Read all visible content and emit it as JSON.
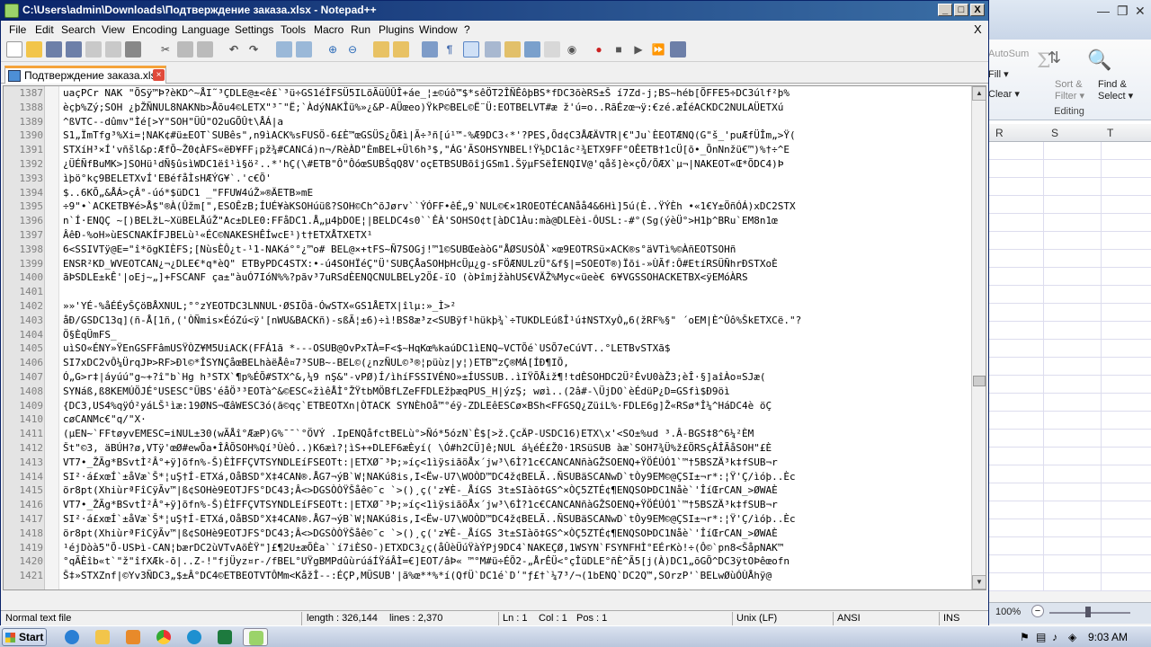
{
  "window": {
    "title": "C:\\Users\\admin\\Downloads\\Подтверждение заказа.xlsx - Notepad++",
    "min": "_",
    "max": "□",
    "close": "X"
  },
  "menu": [
    "File",
    "Edit",
    "Search",
    "View",
    "Encoding",
    "Language",
    "Settings",
    "Tools",
    "Macro",
    "Run",
    "Plugins",
    "Window",
    "?"
  ],
  "menu_close": "X",
  "tab": {
    "label": "Подтверждение заказа.xlsx"
  },
  "editor": {
    "lines": [
      {
        "n": "1387",
        "t": "uaçPCr NAK \"ÕSÿ™Þ?èKD^~ÅI˜³ÇDLE@±<ê£`³ü÷GS1éÎFSÜ5ILõÃüÛÛÎ+áe_¦±©úô™$*sêÖT2ÎÑÊôþBS*fDC3õèRS±Š í7Zd-j;BS~héb[ÕFFE5÷DC3úlf²þ%"
      },
      {
        "n": "1388",
        "t": "èçþ%Zý;SOH ¿þŽÑNUL8NAKNb>Åõu4©LETX\"³¯\"Ë;`ÀdýNAKÎü%»¿&P-AÜœeo)ŸkP©BEL©Ë¨Ü:EOTBELVT#æ ž'ú=o..RãÉzœ¬ÿ:€zé.æÍéACKDC2NULAÜETXú"
      },
      {
        "n": "1389",
        "t": "^ßVTC--dûmv\"Ìé[>Y\"SOH\"ÜÛ\"O2uGÕÛt\\ÅÁ|a"
      },
      {
        "n": "1390",
        "t": "S1„ÏmTfg³%Xi=¦NAK¢#ü±EOT`SUBês\",n9ìACK%sFUSÖ-6£È™œGSÜS¿ÕÆì|Ã÷³ñ[ú¹™-%Æ9DC3‹*'?PES,Õd¢C3ÅÆÄVTR|€\"Ju`ÈEOTÆNQ(G\"š_'puÆfÜÎm„>Ÿ("
      },
      {
        "n": "1391",
        "t": "STXíH³×Í'vñšl&p:ÆfÕ~Ž0¢ÀFS«ëÐ¥FF¡pž¾#CANCá)n¬/RèÀD\"ÈmBEL+Ül6h³$,\"ÁG'ÃSOHSYNBEL!Ÿ½DC1âc²¾ETX9FF°OÊETB†1cÜ[õ•_ÕnNnžü€™)%†÷^E"
      },
      {
        "n": "1392",
        "t": "¿ÜÉÑfBuMK>]SOHü¹dÑ§ûsìWDC1ëî¹ì§ö²..*'hÇ(\\#ETB\"Ô\"ÔóœSUBŠqQ8V'oçETBSUBõîjGSm1.ŠÿµFSëÎENQIV@'qåš]è×çÕ/ÕÆX`µ¬|NAKEOT«Œ*ÕDC4)Þ"
      },
      {
        "n": "1393",
        "t": "ìþö°kç9BELETXvÍ'EBéfåÌsHÆÝG¥`.'c€Õ'"
      },
      {
        "n": "1394",
        "t": "$..6KÕ„&ÅÁ>çÂ°-úó*$üDC1 _\"FFUW4úŽ»®ÄETB»mE"
      },
      {
        "n": "1395",
        "t": "÷9\"•`ACKETB¥é>Å$\"®À(Ûžm[\",ESOÊzB;ÍUÉ¥àKSOHúüß?SOH©Ch^õJørv``ÝÓFF•êÉ„9`NUL©€×1ROEOTÉCANåå4&6Hì]5ú(È..ŸÝÈh •«1€Y±ÖñÓÁ)xDC2STX"
      },
      {
        "n": "1396",
        "t": "n`Í·ENQÇ ~[)BELžL~XüBELÅúŽ\"Ac±DLE0:FFåDC1.Å„µ4þDOE¦|BELDC4s0``ÊÀ'SOHSO¢t[àDC1Àu:mà@DLEèi-ÔUSL:-#°(Sg(ýèÜ°>H1þ^BRu`EM8n1œ"
      },
      {
        "n": "1397",
        "t": "ÂêÐ-%oH»ùESCNAKÍFJBELù¹«ÉC©NAKESHÊÍwcE¹)t†ETXÅTXETX¹"
      },
      {
        "n": "1398",
        "t": "6<SSIVTÿ@E=\"î*õgKIÈFS;[NùsÈÔ¿t-¹1-NAKá°°¿™o# BEL@×+tFS~Ñ7SOGj!™1©SUBŒeàòG\"ÅØSUSÒÅ`×œ9EOTRSü×ACK®s°äVTì%©ÀñEOTSOHñ"
      },
      {
        "n": "1399",
        "t": "ENSR²KD_WVEOTCAN¿¬¿DLE€*q*èQ\" ETByPDC4STX:•-ú4SOHÏéÇ\"Ü'SUBÇÅaSOHþHcÜµ¿g-sFÖÆNULzÜ°&f§|=SOEOT®)Ïõi-»ÙÃf:Ô#EtíRSÜÑhrÐSTXoÈ"
      },
      {
        "n": "1400",
        "t": "ãÞSDLE±kÊ'|oEj~„]+FSCANF ça±\"àuÓ7IóN%%?pãv³7uRSdÈENQCNULBELy2Ö£-ïO (òÞîmjžàhUS€VÄŽ%Myc«üeè€ 6¥VGSSOHACKETBX<ÿEMóÀRS"
      },
      {
        "n": "1401",
        "t": ""
      },
      {
        "n": "1402",
        "t": "»»'YÉ-%åÉÉyŠÇöBÅXNUL;°°zYEOTDC3LNNUL·ØSIÖã-ÓwSTX«GS1ÅETX|îlµ:»_Ì>²"
      },
      {
        "n": "1403",
        "t": "åÐ/GSDC13q](ñ-Å[1ñ,('ÒÑmis×ÉóZú<ÿ'[nWU&BACKñ)-sßÃ¦±6)÷ì!BS8æ³z<SUBÿf¹hükþ¾`÷TUKDLEúßÎ¹ú‡NSTXyÒ„6(žRF%§\" ´oEM|È^Ûô%ŠkETXCë.\"?"
      },
      {
        "n": "1404",
        "t": "Ö§ÈqÜmFS_"
      },
      {
        "n": "1405",
        "t": "uìSO«ÉNY»ŸEnGSFFâmUSŸÒZ¥M5UiACK(FFÁ1ã *---OSUB@OvPxTÀ=F<$~HqKœ%kaúDC1ìENQ~VCTÕé`USÕ7eCúVT..°LETBvSTXã$"
      },
      {
        "n": "1406",
        "t": "SI7xDC2vÔ¼ÜrqJÞ>RF>Ðl©*ÎSYNÇåœBELhàëÅê¤7³SUB~-BEL©(¿nzÑUL©³®¦püùz|y¦)ETB™zÇ®MÁ[ÍÐ¶IŎ,"
      },
      {
        "n": "1407",
        "t": "Ó„G>r‡|áyúú\"g~+?î\"b`Hg h³STX`¶p%ÉÕ#STX^&,¼9 nŞ&\"-vPØ)Í/ìhíFSSIVÉNO»±ÍUSSUB..ìIŸÕÅiž¶!tdÈSOHDC2Ü²ÊvU0àŽ3;èÎ·§]aîÀo¤SJæ("
      },
      {
        "n": "1408",
        "t": "SYNáß,ß8KEMÚÖJÉ°USESC°ÜBS'éåÖ³³EOTà^&©ESC«žìêÅÌ°ŽŸtbMÖBfLZeFFDLEžþæqPUS_H|ýzŞ; wøì..(2â#-\\ÜjDO`èÉdüP¿D=GSfì$Ð9öì"
      },
      {
        "n": "1409",
        "t": "{DC3,US4%qÿÓ²yáLŠ¹ìæ:19ØNS¬ŒâWESC3ó(ã©qç`ETBEOTXn|ÒTACK SYNÈhOå™°éÿ-ZDLEêESCø×BSh<FFGSQ¿ZüiL%·FDLE6g]Ž«RSø*Î¼^HáDC4è öÇ"
      },
      {
        "n": "1410",
        "t": "cøCANMc€\"q/\"X·"
      },
      {
        "n": "1411",
        "t": "(µEN~`FFtøyvEMESC=iNUL±30(wÃÅî°ÆæP)G%¯¯`°ÖVÝ .IpENQåfctBELù°>Ñó*5ózN`È$[>ž.ÇcÄP-USDC16)ETX\\x'<SO±%ud ³.Â-BGS‡8^6¼²ÈM"
      },
      {
        "n": "1412",
        "t": "Št\"©3, äBÚH?ø,VTÿ'œØ#ewÕa•ÎÂÕSOH%Qí³ÙèÓ..)K6æì?¦ìS++DLEF6æÈyí( \\Ó#h2CÜ]ê;NUL á¼éÉ£Ž0·1RSüSUB àæ`SOH7¾Ü%ž£ÖRSçÂÎÃåSOH\"£È"
      },
      {
        "n": "1413",
        "t": "VT7•_ŽÃg*BSvtÌ²Â°+ÿ]õfn%-Š)ÈÌFFÇVTSYNDLEíFSEOTt:|ETXØ¯³Þ;»íç<1ìÿsiãöÅx´jw³\\6Ì?1c€CANCANñàGŽSOENQ+ŸÖÉÚÓ1`™†5BSZÄ³k‡fSUB¬r"
      },
      {
        "n": "1414",
        "t": "SI²·á£xœÍ`±åVæ`Š*¦uŞ†Í-ETXá,OåBSD°X‡4CAN®.ÅG7¬ýB`W¦NAKú8is,I<Ëw-U7\\WOÒD™DC4ž¢BELÃ..ÑSUBäSCANwD`tÒy9EM©@ÇSI±¬r*:¦Ÿ'Ç/ìóþ..Èc"
      },
      {
        "n": "1415",
        "t": "ör8pt(XhiùrªFîCÿÃv™|ß¢SOHè9EOTJFS°DC43;Â<>DGSÒÒŸŠåê©¯c `>()¸ç('z¥È-_ÅíGS 3t±SIàõ‡GS^×ÒÇ5ZTÉ¢¶ENQSOÞDC1Nåè`'ÎíŒrCAN_>ØWAÈ"
      },
      {
        "n": "1416",
        "t": "VT7•_ŽÃg*BSvtÌ²Â°+ÿ]õfn%-Š)ÈÌFFÇVTSYNDLEíFSEOTt:|ETXØ¯³Þ;»íç<1ìÿsiãöÅx´jw³\\6Ì?1c€CANCANñàGŽSOENQ+ŸÖÉÚÓ1`™†5BSZÄ³k‡fSUB¬r"
      },
      {
        "n": "1417",
        "t": "SI²·á£xœÍ`±åVæ`Š*¦uŞ†Í-ETXá,OåBSD°X‡4CAN®.ÅG7¬ýB`W¦NAKú8is,I<Ëw-U7\\WOÒD™DC4ž¢BELÃ..ÑSUBäSCANwD`tÒy9EM©@ÇSI±¬r*:¦Ÿ'Ç/ìóþ..Èc"
      },
      {
        "n": "1418",
        "t": "ör8pt(XhiùrªFîCÿÃv™|ß¢SOHè9EOTJFS°DC43;Â<>DGSÒÒŸŠåê©¯c `>()¸ç('z¥È-_ÅíGS 3t±SIàõ‡GS^×ÒÇ5ZTÉ¢¶ENQSOÞDC1Nåè`'ÎíŒrCAN_>ØWAÈ"
      },
      {
        "n": "1419",
        "t": "¹éjDòà5\"Õ-USÞì-CAN¦bærDC2ùVTvAõÈŸ\"]£¶2U±æÕÈa``í7iÈSO-)ETXDC3¿ç(åÛèÜúŸàÝPj9DC4`NAKEÇØ,1WSYN`FSYNFHÌ°EÉrKò!÷(Ô©`pn8<ŠåpNAK™"
      },
      {
        "n": "1420",
        "t": "°qÃÈîb«t`\"ž\"îfXÆk-õ|..Z-!\"fjÜyz¤r-/fBEL°UŸgBMPdûùrúáÍŸáÂÌ=€]EOT/âÞ« ™°M#ü÷ÉÕ2-„ÅrÊÜ<°çÎüDLE°ñÈ^Ã5[j(À)DC1„õGÕ^DC3ÿtOÞêœofn"
      },
      {
        "n": "1421",
        "t": "Š‡»STXZnf|©Yv3ÑDC3„$±Â°DC4©ETBEOTVTÔMm<KåžÎ--:ÉÇP,MÜSUB'|ã%œ**%*í(QfÜ`DC1é`Dʹ\"ƒ£†`¼7³/¬(1bENQ`DC2Q™,SOrzP'`BELwØùÓÙÅhÿ@"
      }
    ]
  },
  "status": {
    "type": "Normal text file",
    "length": "length : 326,144",
    "lines": "lines : 2,370",
    "ln": "Ln : 1",
    "col": "Col : 1",
    "pos": "Pos : 1",
    "eol": "Unix (LF)",
    "encoding": "ANSI",
    "mode": "INS"
  },
  "excel": {
    "autosum": "AutoSum",
    "fill": "Fill",
    "clear": "Clear",
    "sort": "Sort &",
    "filter": "Filter",
    "find": "Find &",
    "select": "Select",
    "group": "Editing",
    "cols": [
      "R",
      "S",
      "T"
    ],
    "zoom": "100%"
  },
  "taskbar": {
    "start": "Start",
    "clock": "9:03 AM"
  }
}
